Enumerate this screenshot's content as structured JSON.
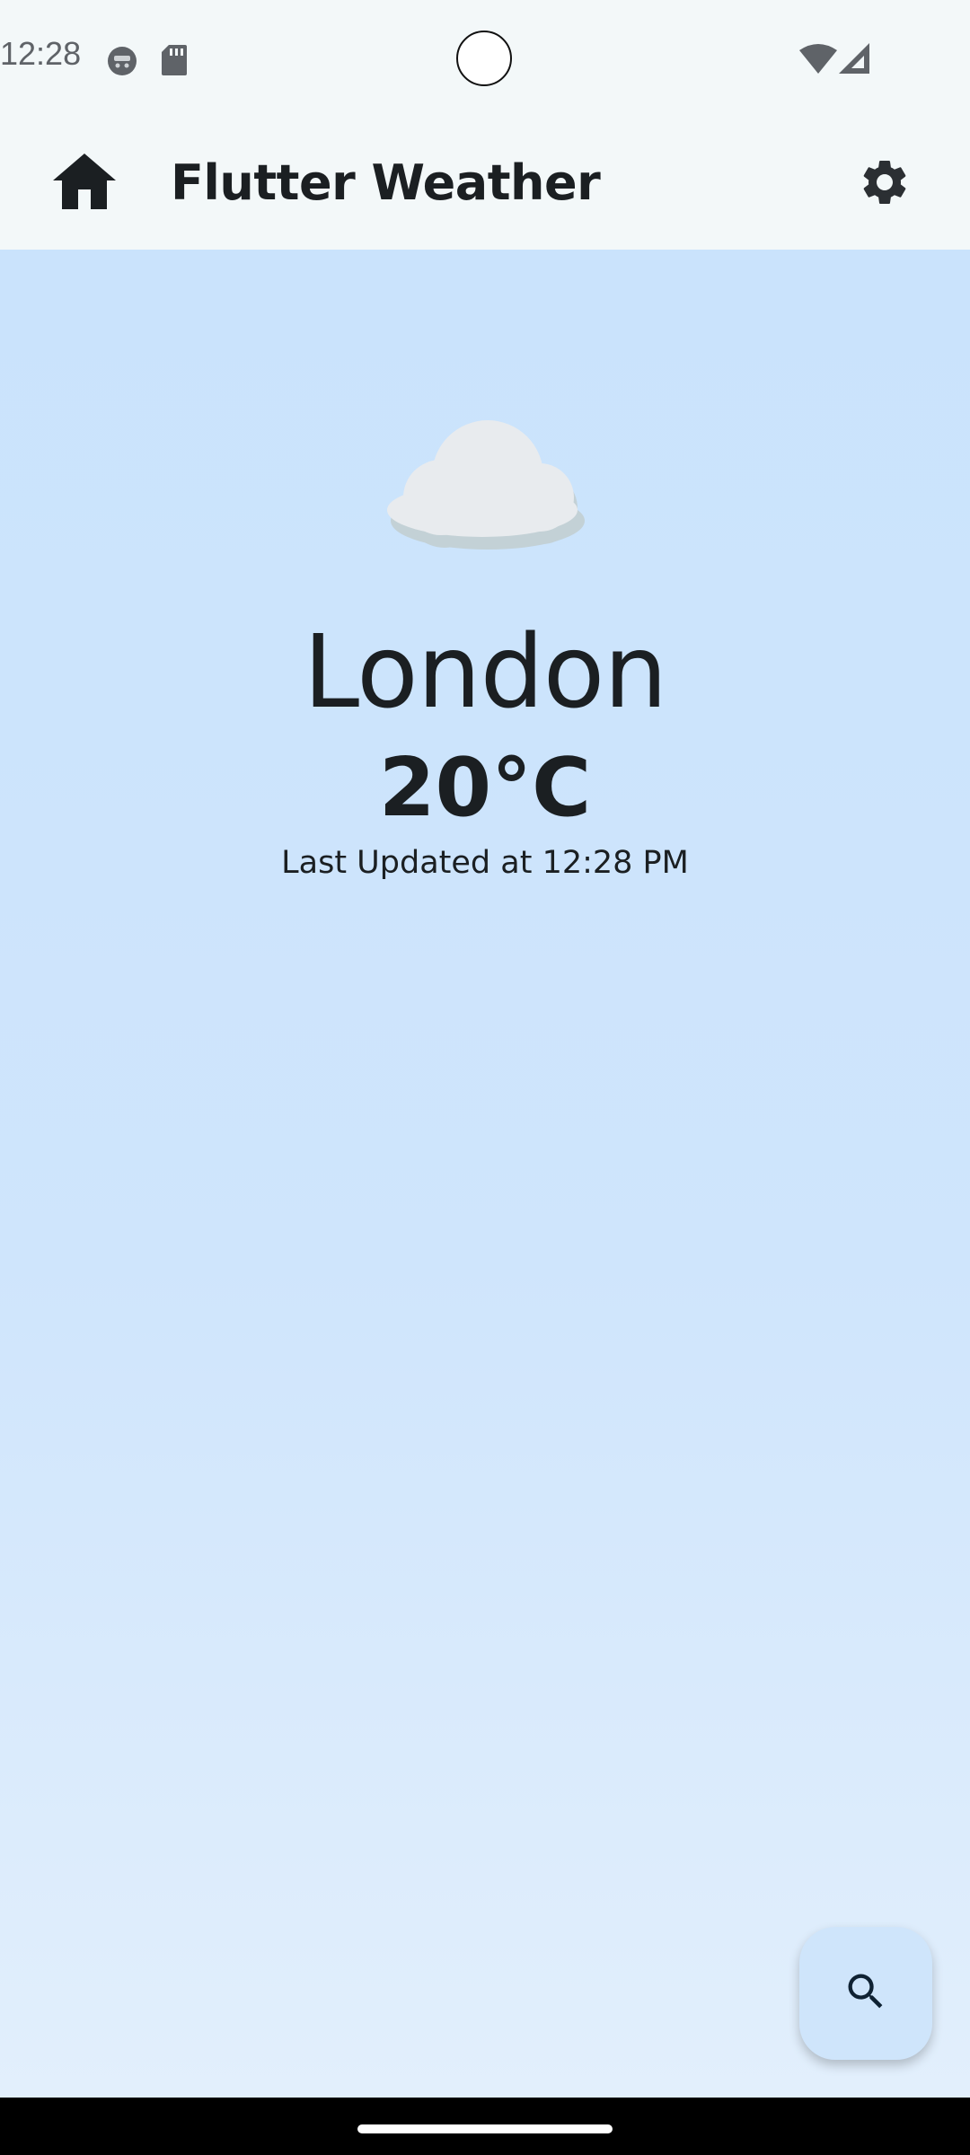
{
  "status_bar": {
    "time": "12:28",
    "icons": [
      "notification-icon",
      "sd-card-icon",
      "wifi-icon",
      "signal-icon"
    ]
  },
  "app_bar": {
    "title": "Flutter Weather",
    "leading_icon": "home-icon",
    "action_icon": "settings-icon"
  },
  "weather": {
    "condition_icon": "cloud-icon",
    "city": "London",
    "temperature": "20°C",
    "last_updated": "Last Updated at 12:28 PM"
  },
  "fab": {
    "icon": "search-icon"
  },
  "colors": {
    "app_bar_bg": "#f3f8f9",
    "body_gradient_top": "#cae3fc",
    "body_gradient_bottom": "#e2effc",
    "text": "#1b1f22",
    "fab_bg": "#cfe5fb"
  }
}
